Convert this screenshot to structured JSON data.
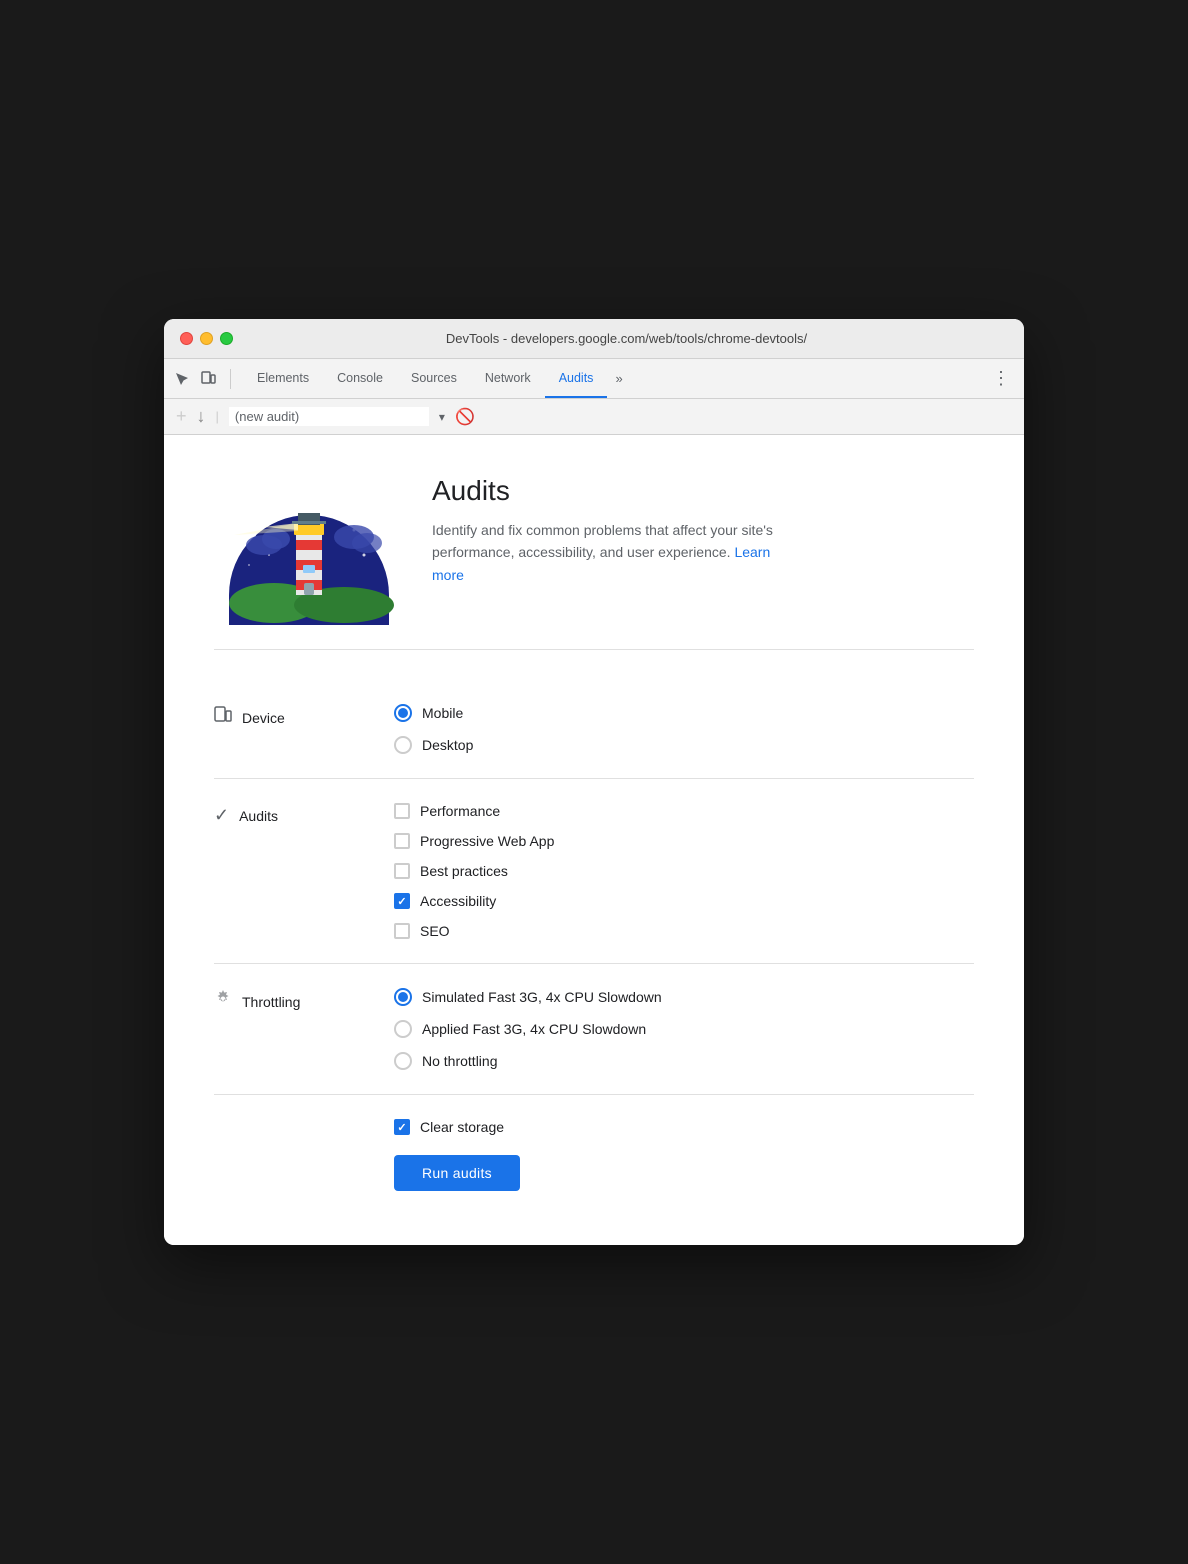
{
  "window": {
    "title": "DevTools - developers.google.com/web/tools/chrome-devtools/"
  },
  "nav": {
    "tabs": [
      {
        "id": "elements",
        "label": "Elements",
        "active": false
      },
      {
        "id": "console",
        "label": "Console",
        "active": false
      },
      {
        "id": "sources",
        "label": "Sources",
        "active": false
      },
      {
        "id": "network",
        "label": "Network",
        "active": false
      },
      {
        "id": "audits",
        "label": "Audits",
        "active": true
      }
    ],
    "more_label": "»",
    "menu_label": "⋮"
  },
  "audit_toolbar": {
    "new_audit_placeholder": "(new audit)",
    "no_entry_icon": "🚫"
  },
  "header": {
    "title": "Audits",
    "description": "Identify and fix common problems that affect your site's performance, accessibility, and user experience.",
    "learn_more": "Learn more"
  },
  "device_section": {
    "label": "Device",
    "options": [
      {
        "id": "mobile",
        "label": "Mobile",
        "selected": true
      },
      {
        "id": "desktop",
        "label": "Desktop",
        "selected": false
      }
    ]
  },
  "audits_section": {
    "label": "Audits",
    "options": [
      {
        "id": "performance",
        "label": "Performance",
        "checked": false
      },
      {
        "id": "pwa",
        "label": "Progressive Web App",
        "checked": false
      },
      {
        "id": "best-practices",
        "label": "Best practices",
        "checked": false
      },
      {
        "id": "accessibility",
        "label": "Accessibility",
        "checked": true
      },
      {
        "id": "seo",
        "label": "SEO",
        "checked": false
      }
    ]
  },
  "throttling_section": {
    "label": "Throttling",
    "options": [
      {
        "id": "simulated",
        "label": "Simulated Fast 3G, 4x CPU Slowdown",
        "selected": true
      },
      {
        "id": "applied",
        "label": "Applied Fast 3G, 4x CPU Slowdown",
        "selected": false
      },
      {
        "id": "none",
        "label": "No throttling",
        "selected": false
      }
    ]
  },
  "run": {
    "clear_storage_label": "Clear storage",
    "clear_storage_checked": true,
    "run_button": "Run audits"
  }
}
